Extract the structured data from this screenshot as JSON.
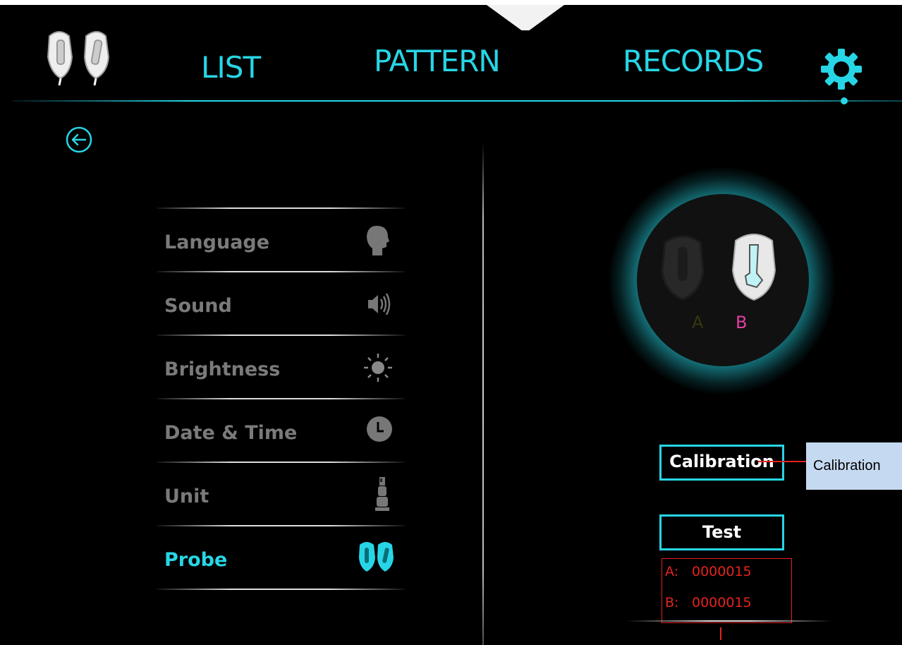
{
  "nav": {
    "list": "LIST",
    "pattern": "PATTERN",
    "records": "RECORDS"
  },
  "menu": {
    "items": [
      {
        "label": "Language",
        "icon": "head-speaking-icon"
      },
      {
        "label": "Sound",
        "icon": "speaker-icon"
      },
      {
        "label": "Brightness",
        "icon": "sun-icon"
      },
      {
        "label": "Date & Time",
        "icon": "clock-icon"
      },
      {
        "label": "Unit",
        "icon": "device-icon"
      },
      {
        "label": "Probe",
        "icon": "probes-icon",
        "active": true
      }
    ]
  },
  "probe_panel": {
    "label_a": "A",
    "label_b": "B",
    "calibration_button": "Calibration",
    "test_button": "Test",
    "counters": [
      {
        "key": "A:",
        "value": "0000015"
      },
      {
        "key": "B:",
        "value": "0000015"
      }
    ]
  },
  "annotation": {
    "callout": "Calibration"
  },
  "colors": {
    "accent": "#27d6e6",
    "inactive_text": "#7a7a7a",
    "probe_b_label": "#e23fa0",
    "annotation_red": "#e3231f",
    "callout_bg": "#c5d9f1"
  }
}
